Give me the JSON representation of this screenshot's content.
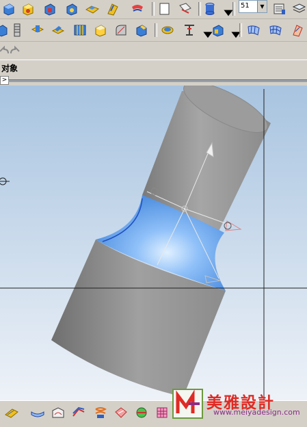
{
  "objects_label": "对象",
  "layer_combo": {
    "value": "51"
  },
  "tab_marker": ">",
  "watermark": {
    "title": "美雅設計",
    "url": "www.meiyadesign.com"
  },
  "colors": {
    "surface_gray": "#8f8f8f",
    "highlight_blue": "#6aa8f0",
    "viewport_top": "#a8c4e0",
    "viewport_bottom": "#eef2f8"
  }
}
